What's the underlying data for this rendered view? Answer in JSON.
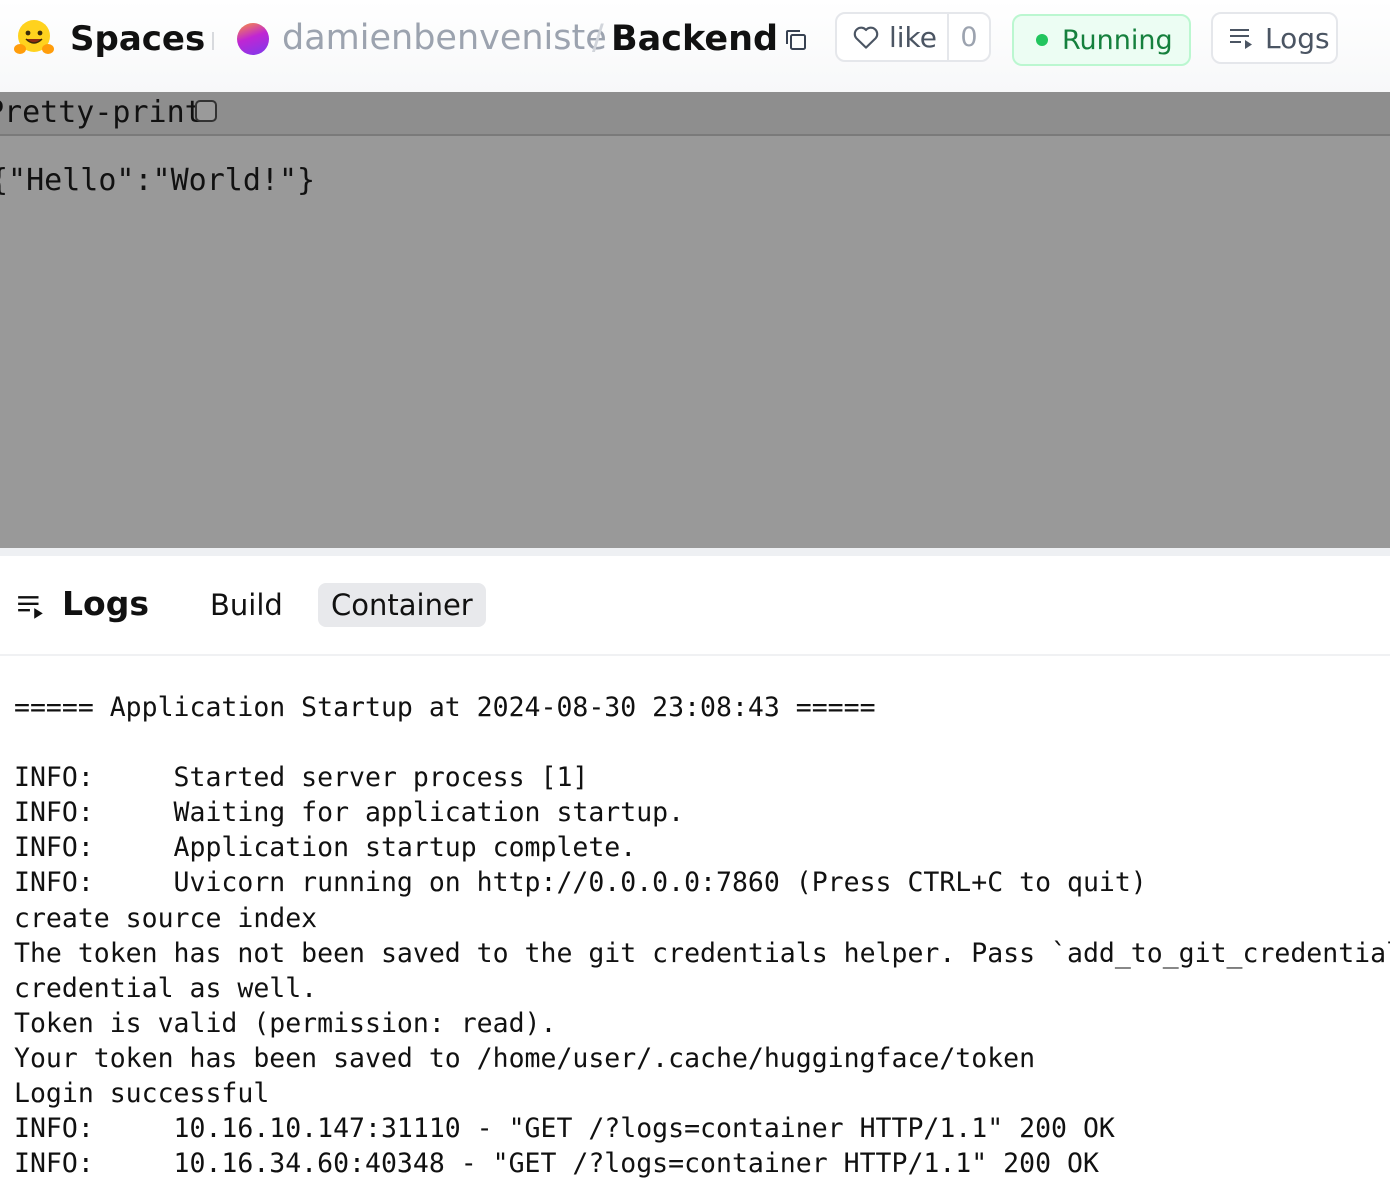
{
  "header": {
    "brand": "Spaces",
    "owner": "damienbenveniste",
    "separator": "/",
    "repo": "Backend",
    "like_label": "like",
    "like_count": "0",
    "status": "Running",
    "logs_label": "Logs",
    "status_color": "#22c55e"
  },
  "app": {
    "pretty_print_label": "Pretty-print",
    "pretty_print_checked": false,
    "json_output": "{\"Hello\":\"World!\"}"
  },
  "logs": {
    "title": "Logs",
    "tabs": [
      "Build",
      "Container"
    ],
    "active_tab": "Container",
    "lines": [
      "===== Application Startup at 2024-08-30 23:08:43 =====",
      "",
      "INFO:     Started server process [1]",
      "INFO:     Waiting for application startup.",
      "INFO:     Application startup complete.",
      "INFO:     Uvicorn running on http://0.0.0.0:7860 (Press CTRL+C to quit)",
      "create source index",
      "The token has not been saved to the git credentials helper. Pass `add_to_git_credential",
      "credential as well.",
      "Token is valid (permission: read).",
      "Your token has been saved to /home/user/.cache/huggingface/token",
      "Login successful",
      "INFO:     10.16.10.147:31110 - \"GET /?logs=container HTTP/1.1\" 200 OK",
      "INFO:     10.16.34.60:40348 - \"GET /?logs=container HTTP/1.1\" 200 OK"
    ]
  }
}
